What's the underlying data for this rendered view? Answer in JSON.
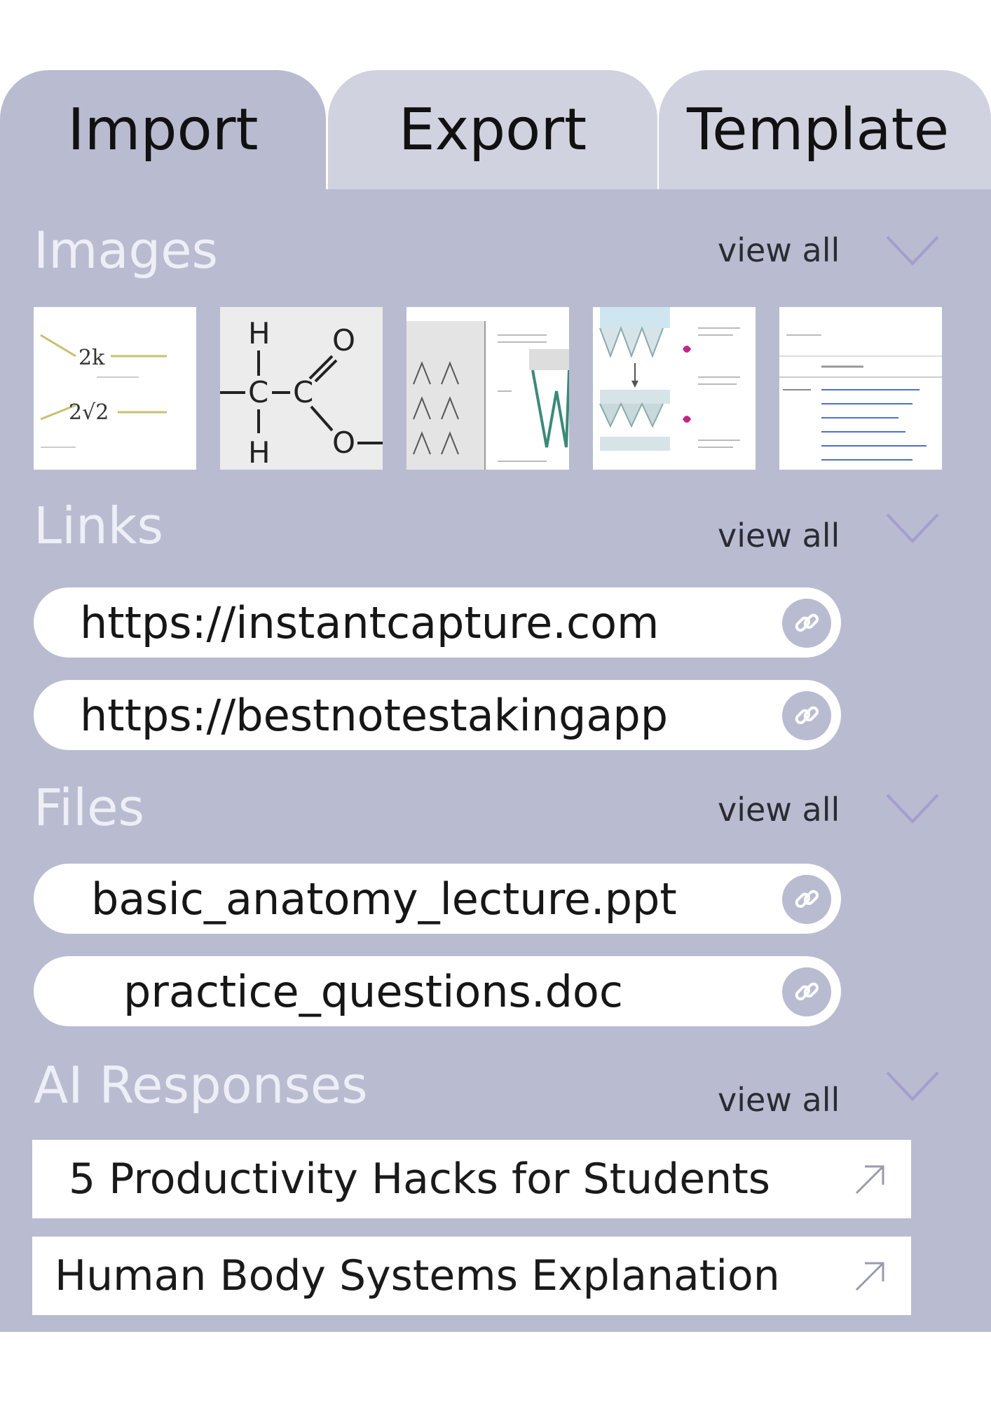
{
  "tabs": [
    {
      "label": "Import",
      "active": true
    },
    {
      "label": "Export",
      "active": false
    },
    {
      "label": "Template",
      "active": false
    }
  ],
  "sections": {
    "images": {
      "title": "Images",
      "view_all": "view all"
    },
    "links": {
      "title": "Links",
      "view_all": "view all"
    },
    "files": {
      "title": "Files",
      "view_all": "view all"
    },
    "ai": {
      "title": "AI Responses",
      "view_all": "view all"
    }
  },
  "links": [
    {
      "text": "https://instantcapture.com"
    },
    {
      "text": "https://bestnotestakingapp"
    }
  ],
  "files": [
    {
      "text": "basic_anatomy_lecture.ppt"
    },
    {
      "text": "practice_questions.doc"
    }
  ],
  "ai_responses": [
    {
      "text": "5 Productivity Hacks for Students"
    },
    {
      "text": "Human Body Systems Explanation"
    }
  ],
  "thumb_formula": {
    "h_top": "H",
    "o_top": "O",
    "c1": "C",
    "c2": "C",
    "h_bottom": "H",
    "o_bottom": "O"
  },
  "colors": {
    "panel": "#b9bbd0",
    "inactive_tab": "#d1d2df",
    "chevron": "#a59cd0",
    "section_title": "#eeeff6"
  },
  "icons": {
    "chevron": "chevron-down-icon",
    "link": "link-icon",
    "arrow": "external-arrow-icon"
  }
}
